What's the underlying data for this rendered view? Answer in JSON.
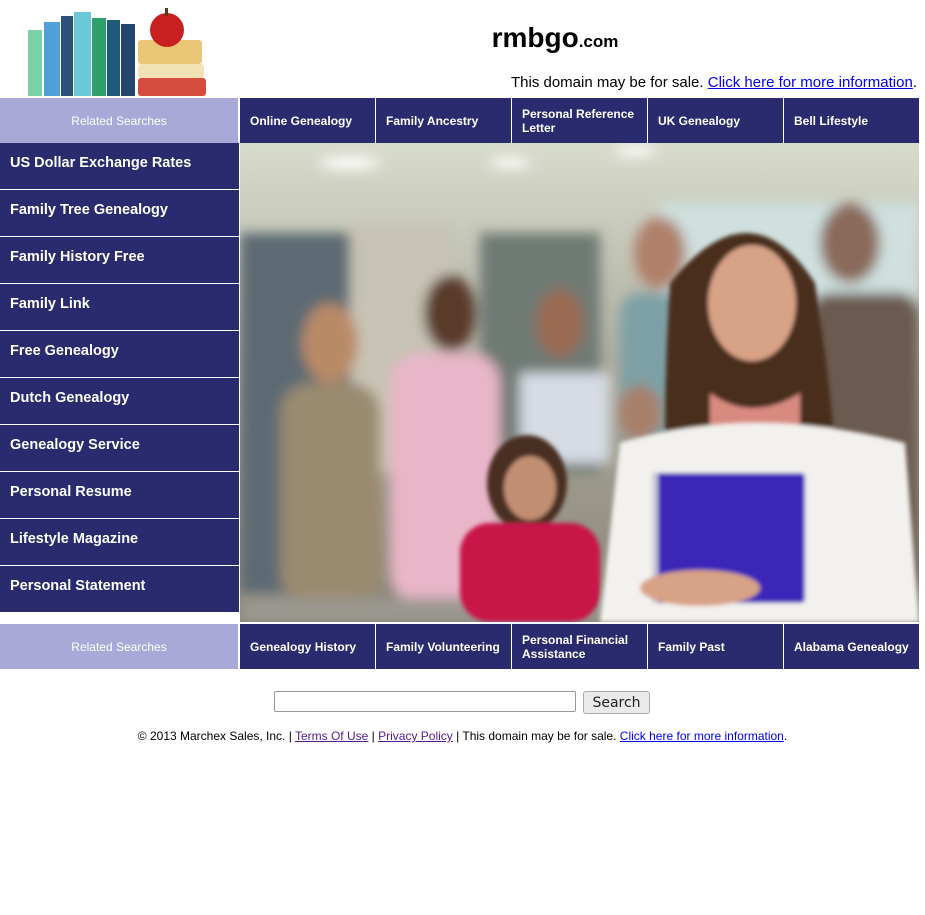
{
  "header": {
    "domain_name": "rmbgo",
    "domain_tld": ".com",
    "sale_text": "This domain may be for sale.",
    "sale_link": "Click here for more information",
    "sale_period": "."
  },
  "top_bar": {
    "label": "Related Searches",
    "links": [
      "Online Genealogy",
      "Family Ancestry",
      "Personal Reference Letter",
      "UK Genealogy",
      "Bell Lifestyle"
    ]
  },
  "side_menu": {
    "items": [
      "US Dollar Exchange Rates",
      "Family Tree Genealogy",
      "Family History Free",
      "Family Link",
      "Free Genealogy",
      "Dutch Genealogy",
      "Genealogy Service",
      "Personal Resume",
      "Lifestyle Magazine",
      "Personal Statement"
    ]
  },
  "bottom_bar": {
    "label": "Related Searches",
    "links": [
      "Genealogy History",
      "Family Volunteering",
      "Personal Financial Assistance",
      "Family Past",
      "Alabama Genealogy"
    ]
  },
  "search": {
    "placeholder": "",
    "button_label": "Search"
  },
  "footer": {
    "copyright": "© 2013 Marchex Sales, Inc. |",
    "terms": "Terms Of Use",
    "sep": "|",
    "privacy": "Privacy Policy",
    "sale_text": "| This domain may be for sale.",
    "sale_link": "Click here for more information",
    "period": "."
  },
  "colors": {
    "nav_bg": "#2a2a6e",
    "label_bg": "#a9a9d8",
    "link": "#0000ee",
    "visited": "#551a8b"
  }
}
